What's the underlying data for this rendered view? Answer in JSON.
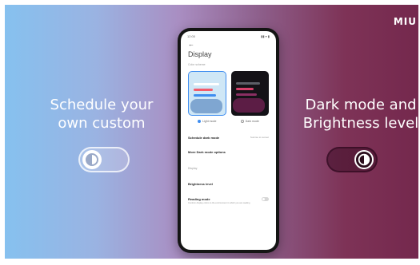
{
  "brand": {
    "logo": "MIU"
  },
  "features": {
    "left": {
      "line1": "Schedule your",
      "line2": "own custom"
    },
    "right": {
      "line1": "Dark mode and",
      "line2": "Brightness level"
    }
  },
  "phone": {
    "status_time": "12:00",
    "status_icons": "▮▮ ▾ ▮",
    "back_glyph": "←",
    "title": "Display",
    "section_caption": "Color scheme",
    "themes": [
      {
        "label": "Light mode"
      },
      {
        "label": "Dark mode"
      }
    ],
    "settings": {
      "schedule_dark_mode": "Schedule dark mode",
      "schedule_dark_mode_value": "Sunrise to sunset",
      "more_dark_mode_options": "More Dark mode options",
      "group_caption": "Display",
      "brightness_level": "Brightness level",
      "reading_mode": "Reading mode",
      "reading_mode_desc": "Conform display colors to the environment in which you are reading"
    }
  },
  "colors": {
    "gradient_start": "#86c1ef",
    "gradient_end": "#74284d",
    "accent": "#3e8df0"
  }
}
